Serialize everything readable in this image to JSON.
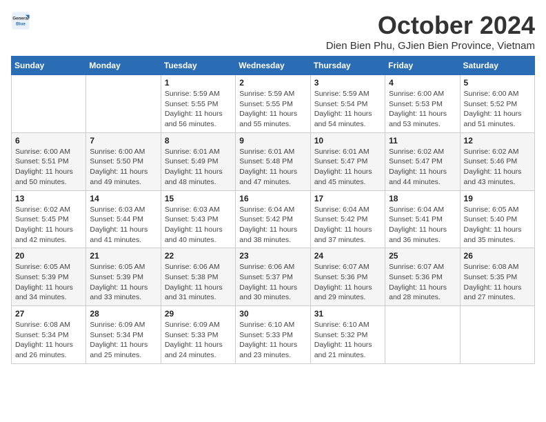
{
  "logo": {
    "general": "General",
    "blue": "Blue"
  },
  "header": {
    "month": "October 2024",
    "location": "Dien Bien Phu, GJien Bien Province, Vietnam"
  },
  "weekdays": [
    "Sunday",
    "Monday",
    "Tuesday",
    "Wednesday",
    "Thursday",
    "Friday",
    "Saturday"
  ],
  "weeks": [
    [
      {
        "day": "",
        "detail": ""
      },
      {
        "day": "",
        "detail": ""
      },
      {
        "day": "1",
        "detail": "Sunrise: 5:59 AM\nSunset: 5:55 PM\nDaylight: 11 hours and 56 minutes."
      },
      {
        "day": "2",
        "detail": "Sunrise: 5:59 AM\nSunset: 5:55 PM\nDaylight: 11 hours and 55 minutes."
      },
      {
        "day": "3",
        "detail": "Sunrise: 5:59 AM\nSunset: 5:54 PM\nDaylight: 11 hours and 54 minutes."
      },
      {
        "day": "4",
        "detail": "Sunrise: 6:00 AM\nSunset: 5:53 PM\nDaylight: 11 hours and 53 minutes."
      },
      {
        "day": "5",
        "detail": "Sunrise: 6:00 AM\nSunset: 5:52 PM\nDaylight: 11 hours and 51 minutes."
      }
    ],
    [
      {
        "day": "6",
        "detail": "Sunrise: 6:00 AM\nSunset: 5:51 PM\nDaylight: 11 hours and 50 minutes."
      },
      {
        "day": "7",
        "detail": "Sunrise: 6:00 AM\nSunset: 5:50 PM\nDaylight: 11 hours and 49 minutes."
      },
      {
        "day": "8",
        "detail": "Sunrise: 6:01 AM\nSunset: 5:49 PM\nDaylight: 11 hours and 48 minutes."
      },
      {
        "day": "9",
        "detail": "Sunrise: 6:01 AM\nSunset: 5:48 PM\nDaylight: 11 hours and 47 minutes."
      },
      {
        "day": "10",
        "detail": "Sunrise: 6:01 AM\nSunset: 5:47 PM\nDaylight: 11 hours and 45 minutes."
      },
      {
        "day": "11",
        "detail": "Sunrise: 6:02 AM\nSunset: 5:47 PM\nDaylight: 11 hours and 44 minutes."
      },
      {
        "day": "12",
        "detail": "Sunrise: 6:02 AM\nSunset: 5:46 PM\nDaylight: 11 hours and 43 minutes."
      }
    ],
    [
      {
        "day": "13",
        "detail": "Sunrise: 6:02 AM\nSunset: 5:45 PM\nDaylight: 11 hours and 42 minutes."
      },
      {
        "day": "14",
        "detail": "Sunrise: 6:03 AM\nSunset: 5:44 PM\nDaylight: 11 hours and 41 minutes."
      },
      {
        "day": "15",
        "detail": "Sunrise: 6:03 AM\nSunset: 5:43 PM\nDaylight: 11 hours and 40 minutes."
      },
      {
        "day": "16",
        "detail": "Sunrise: 6:04 AM\nSunset: 5:42 PM\nDaylight: 11 hours and 38 minutes."
      },
      {
        "day": "17",
        "detail": "Sunrise: 6:04 AM\nSunset: 5:42 PM\nDaylight: 11 hours and 37 minutes."
      },
      {
        "day": "18",
        "detail": "Sunrise: 6:04 AM\nSunset: 5:41 PM\nDaylight: 11 hours and 36 minutes."
      },
      {
        "day": "19",
        "detail": "Sunrise: 6:05 AM\nSunset: 5:40 PM\nDaylight: 11 hours and 35 minutes."
      }
    ],
    [
      {
        "day": "20",
        "detail": "Sunrise: 6:05 AM\nSunset: 5:39 PM\nDaylight: 11 hours and 34 minutes."
      },
      {
        "day": "21",
        "detail": "Sunrise: 6:05 AM\nSunset: 5:39 PM\nDaylight: 11 hours and 33 minutes."
      },
      {
        "day": "22",
        "detail": "Sunrise: 6:06 AM\nSunset: 5:38 PM\nDaylight: 11 hours and 31 minutes."
      },
      {
        "day": "23",
        "detail": "Sunrise: 6:06 AM\nSunset: 5:37 PM\nDaylight: 11 hours and 30 minutes."
      },
      {
        "day": "24",
        "detail": "Sunrise: 6:07 AM\nSunset: 5:36 PM\nDaylight: 11 hours and 29 minutes."
      },
      {
        "day": "25",
        "detail": "Sunrise: 6:07 AM\nSunset: 5:36 PM\nDaylight: 11 hours and 28 minutes."
      },
      {
        "day": "26",
        "detail": "Sunrise: 6:08 AM\nSunset: 5:35 PM\nDaylight: 11 hours and 27 minutes."
      }
    ],
    [
      {
        "day": "27",
        "detail": "Sunrise: 6:08 AM\nSunset: 5:34 PM\nDaylight: 11 hours and 26 minutes."
      },
      {
        "day": "28",
        "detail": "Sunrise: 6:09 AM\nSunset: 5:34 PM\nDaylight: 11 hours and 25 minutes."
      },
      {
        "day": "29",
        "detail": "Sunrise: 6:09 AM\nSunset: 5:33 PM\nDaylight: 11 hours and 24 minutes."
      },
      {
        "day": "30",
        "detail": "Sunrise: 6:10 AM\nSunset: 5:33 PM\nDaylight: 11 hours and 23 minutes."
      },
      {
        "day": "31",
        "detail": "Sunrise: 6:10 AM\nSunset: 5:32 PM\nDaylight: 11 hours and 21 minutes."
      },
      {
        "day": "",
        "detail": ""
      },
      {
        "day": "",
        "detail": ""
      }
    ]
  ]
}
